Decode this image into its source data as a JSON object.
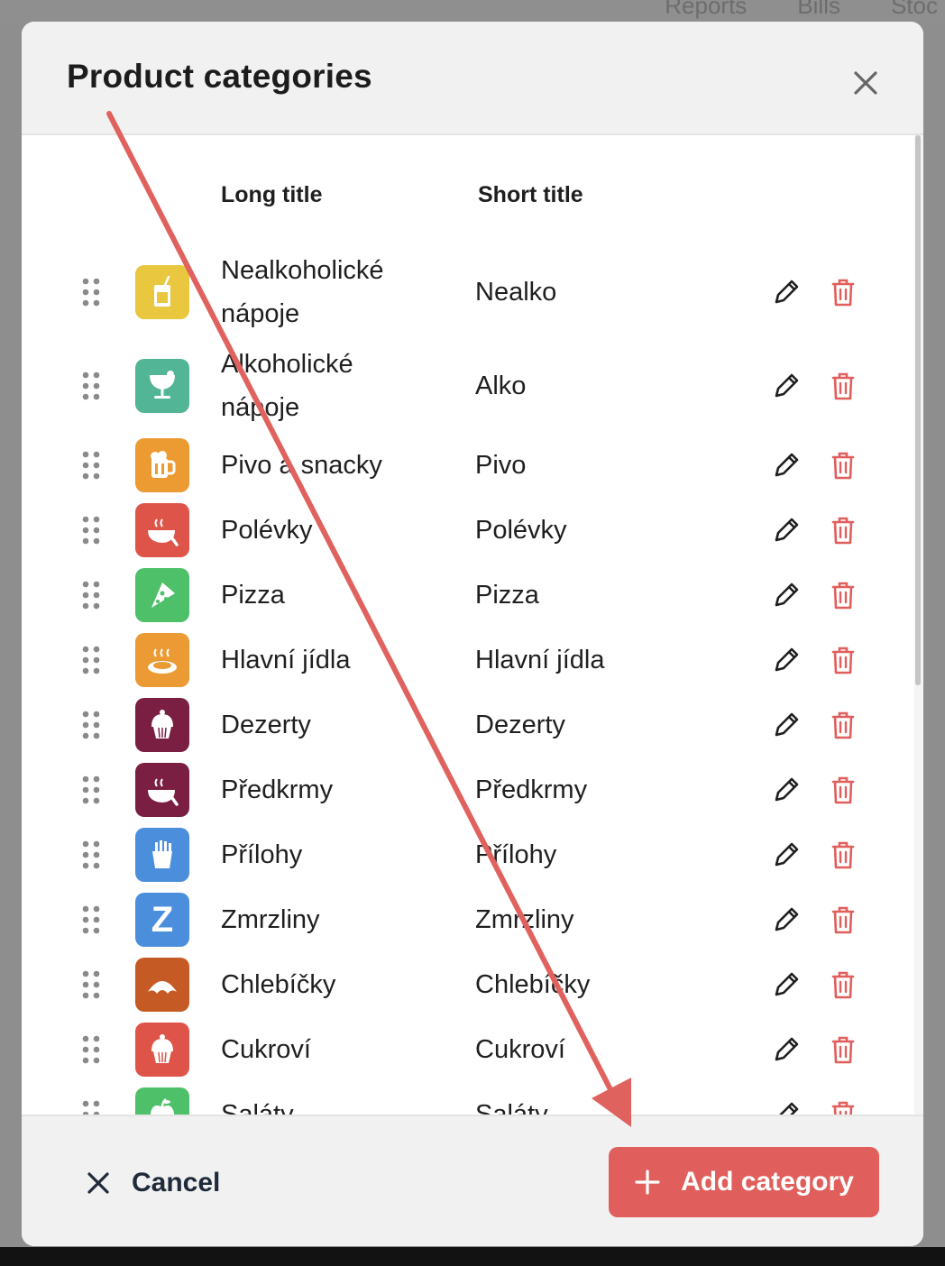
{
  "background": {
    "tabs": [
      "Reports",
      "Bills",
      "Stoc"
    ]
  },
  "dialog": {
    "title": "Product categories",
    "columns": {
      "long_title": "Long title",
      "short_title": "Short title"
    },
    "categories": [
      {
        "long": "Nealkoholické nápoje",
        "short": "Nealko",
        "icon": "drink-icon",
        "color": "#e9c73e"
      },
      {
        "long": "Alkoholické nápoje",
        "short": "Alko",
        "icon": "cocktail-icon",
        "color": "#52b596"
      },
      {
        "long": "Pivo a snacky",
        "short": "Pivo",
        "icon": "beer-mug-icon",
        "color": "#ec9b33"
      },
      {
        "long": "Polévky",
        "short": "Polévky",
        "icon": "soup-bowl-icon",
        "color": "#de5448"
      },
      {
        "long": "Pizza",
        "short": "Pizza",
        "icon": "pizza-slice-icon",
        "color": "#4fc06a"
      },
      {
        "long": "Hlavní jídla",
        "short": "Hlavní jídla",
        "icon": "hot-plate-icon",
        "color": "#eb9a34"
      },
      {
        "long": "Dezerty",
        "short": "Dezerty",
        "icon": "cupcake-icon",
        "color": "#7a1e42"
      },
      {
        "long": "Předkrmy",
        "short": "Předkrmy",
        "icon": "soup-bowl-icon",
        "color": "#7a1e42"
      },
      {
        "long": "Přílohy",
        "short": "Přílohy",
        "icon": "fries-icon",
        "color": "#4b8fdc"
      },
      {
        "long": "Zmrzliny",
        "short": "Zmrzliny",
        "icon": "letter-z-icon",
        "color": "#4b8fdc"
      },
      {
        "long": "Chlebíčky",
        "short": "Chlebíčky",
        "icon": "croissant-icon",
        "color": "#c65a24"
      },
      {
        "long": "Cukroví",
        "short": "Cukroví",
        "icon": "cupcake-icon",
        "color": "#de5448"
      },
      {
        "long": "Saláty",
        "short": "Saláty",
        "icon": "apple-icon",
        "color": "#4fc06a"
      }
    ],
    "icon_letter_z": "Z",
    "cancel_label": "Cancel",
    "add_label": "Add category"
  },
  "colors": {
    "accent": "#e05f5c",
    "delete": "#e05f5c",
    "annotation_arrow": "#e0625f"
  }
}
